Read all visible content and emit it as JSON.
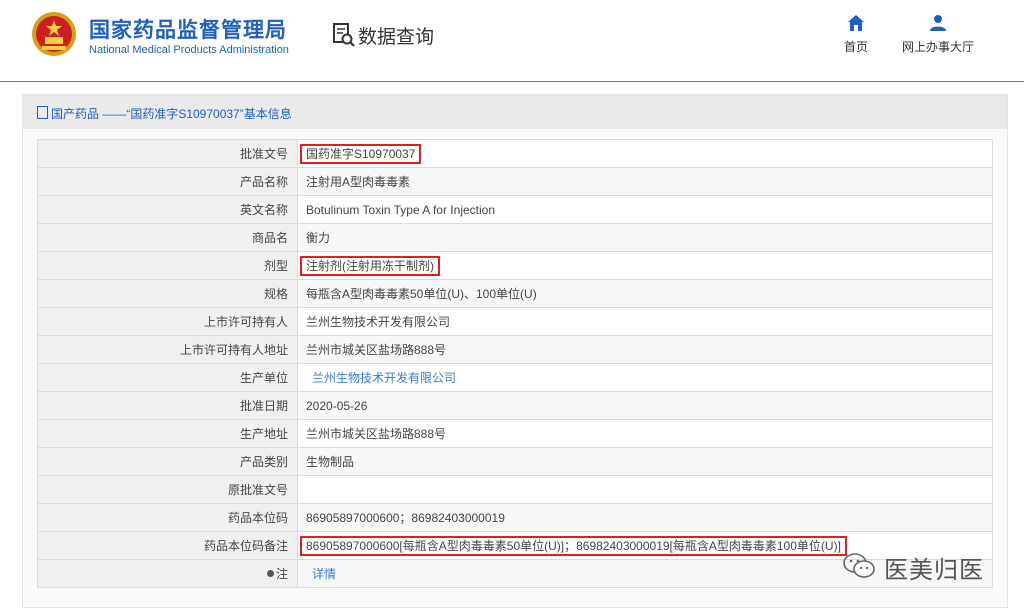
{
  "header": {
    "org_name_cn": "国家药品监督管理局",
    "org_name_en": "National Medical Products Administration",
    "section_title": "数据查询",
    "nav": [
      {
        "label": "首页",
        "icon": "home-icon"
      },
      {
        "label": "网上办事大厅",
        "icon": "user-icon"
      }
    ]
  },
  "panel": {
    "title": "国产药品 ——“国药准字S10970037”基本信息"
  },
  "rows": [
    {
      "label": "批准文号",
      "value": "国药准字S10970037"
    },
    {
      "label": "产品名称",
      "value": "注射用A型肉毒毒素"
    },
    {
      "label": "英文名称",
      "value": "Botulinum Toxin Type A for Injection"
    },
    {
      "label": "商品名",
      "value": "衡力"
    },
    {
      "label": "剂型",
      "value": "注射剂(注射用冻干制剂)"
    },
    {
      "label": "规格",
      "value": "每瓶含A型肉毒毒素50单位(U)、100单位(U)"
    },
    {
      "label": "上市许可持有人",
      "value": "兰州生物技术开发有限公司"
    },
    {
      "label": "上市许可持有人地址",
      "value": "兰州市城关区盐场路888号"
    },
    {
      "label": "生产单位",
      "value": "兰州生物技术开发有限公司"
    },
    {
      "label": "批准日期",
      "value": "2020-05-26"
    },
    {
      "label": "生产地址",
      "value": "兰州市城关区盐场路888号"
    },
    {
      "label": "产品类别",
      "value": "生物制品"
    },
    {
      "label": "原批准文号",
      "value": ""
    },
    {
      "label": "药品本位码",
      "value": "86905897000600；86982403000019"
    },
    {
      "label": "药品本位码备注",
      "value": "86905897000600[每瓶含A型肉毒毒素50单位(U)]；86982403000019[每瓶含A型肉毒毒素100单位(U)]"
    },
    {
      "label": "注",
      "value": "详情"
    }
  ],
  "watermark": {
    "text": "医美归医"
  },
  "colors": {
    "brand": "#1f5fbf",
    "link": "#3a7bd5",
    "highlight": "#e02020"
  }
}
